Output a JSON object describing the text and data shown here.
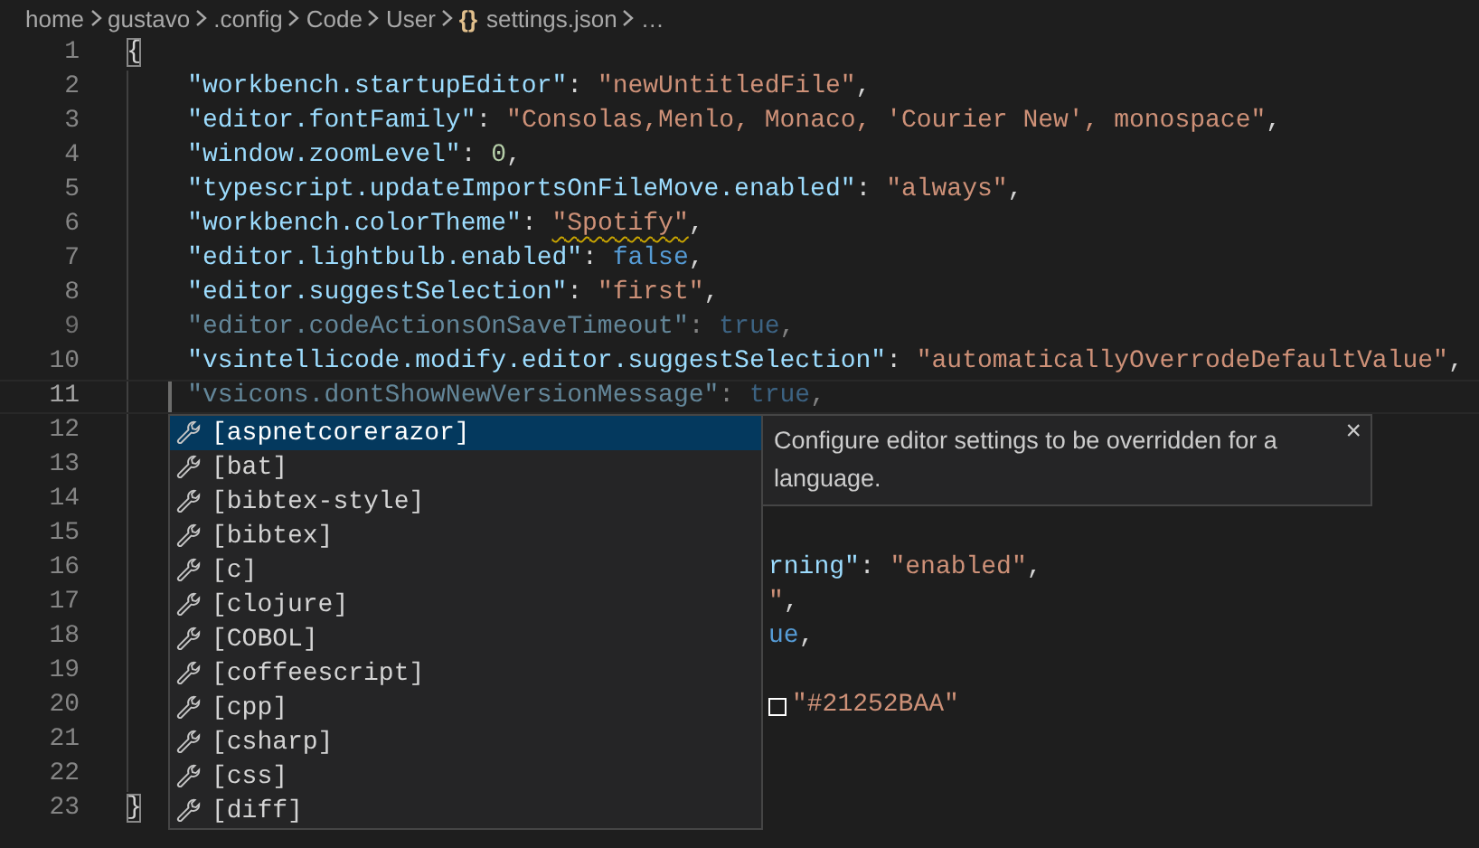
{
  "breadcrumb": {
    "items": [
      {
        "label": "home"
      },
      {
        "label": "gustavo"
      },
      {
        "label": ".config"
      },
      {
        "label": "Code"
      },
      {
        "label": "User"
      },
      {
        "label": "settings.json",
        "icon": "{}"
      },
      {
        "label": "…"
      }
    ]
  },
  "editor": {
    "lines": [
      {
        "number": "1",
        "kind": "full",
        "dimmed": false,
        "current": false,
        "tokens": [
          {
            "text": "{",
            "kind": "bracket-match"
          }
        ]
      },
      {
        "number": "2",
        "kind": "entry",
        "dimmed": false,
        "current": false,
        "tokens": [
          {
            "text": "\"workbench.startupEditor\"",
            "kind": "key"
          },
          {
            "text": ": ",
            "kind": "punct"
          },
          {
            "text": "\"newUntitledFile\"",
            "kind": "string"
          },
          {
            "text": ",",
            "kind": "punct"
          }
        ]
      },
      {
        "number": "3",
        "kind": "entry",
        "dimmed": false,
        "current": false,
        "tokens": [
          {
            "text": "\"editor.fontFamily\"",
            "kind": "key"
          },
          {
            "text": ": ",
            "kind": "punct"
          },
          {
            "text": "\"Consolas,Menlo, Monaco, 'Courier New', monospace\"",
            "kind": "string"
          },
          {
            "text": ",",
            "kind": "punct"
          }
        ]
      },
      {
        "number": "4",
        "kind": "entry",
        "dimmed": false,
        "current": false,
        "tokens": [
          {
            "text": "\"window.zoomLevel\"",
            "kind": "key"
          },
          {
            "text": ": ",
            "kind": "punct"
          },
          {
            "text": "0",
            "kind": "number"
          },
          {
            "text": ",",
            "kind": "punct"
          }
        ]
      },
      {
        "number": "5",
        "kind": "entry",
        "dimmed": false,
        "current": false,
        "tokens": [
          {
            "text": "\"typescript.updateImportsOnFileMove.enabled\"",
            "kind": "key"
          },
          {
            "text": ": ",
            "kind": "punct"
          },
          {
            "text": "\"always\"",
            "kind": "string"
          },
          {
            "text": ",",
            "kind": "punct"
          }
        ]
      },
      {
        "number": "6",
        "kind": "entry",
        "dimmed": false,
        "current": false,
        "tokens": [
          {
            "text": "\"workbench.colorTheme\"",
            "kind": "key"
          },
          {
            "text": ": ",
            "kind": "punct"
          },
          {
            "text": "\"Spotify\"",
            "kind": "warning-string"
          },
          {
            "text": ",",
            "kind": "punct"
          }
        ]
      },
      {
        "number": "7",
        "kind": "entry",
        "dimmed": false,
        "current": false,
        "tokens": [
          {
            "text": "\"editor.lightbulb.enabled\"",
            "kind": "key"
          },
          {
            "text": ": ",
            "kind": "punct"
          },
          {
            "text": "false",
            "kind": "bool"
          },
          {
            "text": ",",
            "kind": "punct"
          }
        ]
      },
      {
        "number": "8",
        "kind": "entry",
        "dimmed": false,
        "current": false,
        "tokens": [
          {
            "text": "\"editor.suggestSelection\"",
            "kind": "key"
          },
          {
            "text": ": ",
            "kind": "punct"
          },
          {
            "text": "\"first\"",
            "kind": "string"
          },
          {
            "text": ",",
            "kind": "punct"
          }
        ]
      },
      {
        "number": "9",
        "kind": "entry",
        "dimmed": true,
        "current": false,
        "tokens": [
          {
            "text": "\"editor.codeActionsOnSaveTimeout\"",
            "kind": "key"
          },
          {
            "text": ": ",
            "kind": "punct"
          },
          {
            "text": "true",
            "kind": "bool"
          },
          {
            "text": ",",
            "kind": "punct"
          }
        ]
      },
      {
        "number": "10",
        "kind": "entry",
        "dimmed": false,
        "current": false,
        "tokens": [
          {
            "text": "\"vsintellicode.modify.editor.suggestSelection\"",
            "kind": "key"
          },
          {
            "text": ": ",
            "kind": "punct"
          },
          {
            "text": "\"automaticallyOverrodeDefaultValue\"",
            "kind": "string"
          },
          {
            "text": ",",
            "kind": "punct"
          }
        ]
      },
      {
        "number": "11",
        "kind": "entry",
        "dimmed": true,
        "current": true,
        "tokens": [
          {
            "text": "\"vsicons.dontShowNewVersionMessage\"",
            "kind": "key"
          },
          {
            "text": ": ",
            "kind": "punct"
          },
          {
            "text": "true",
            "kind": "bool"
          },
          {
            "text": ",",
            "kind": "punct"
          }
        ]
      },
      {
        "number": "12",
        "kind": "partial",
        "dimmed": false,
        "current": false
      },
      {
        "number": "13",
        "kind": "partial",
        "dimmed": false,
        "current": false
      },
      {
        "number": "14",
        "kind": "partial",
        "dimmed": false,
        "current": false
      },
      {
        "number": "15",
        "kind": "partial",
        "dimmed": false,
        "current": false
      },
      {
        "number": "16",
        "kind": "partial",
        "dimmed": false,
        "current": false,
        "tokens": [
          {
            "text": "rning\"",
            "kind": "key"
          },
          {
            "text": ": ",
            "kind": "punct"
          },
          {
            "text": "\"enabled\"",
            "kind": "string"
          },
          {
            "text": ",",
            "kind": "punct"
          }
        ]
      },
      {
        "number": "17",
        "kind": "partial",
        "dimmed": false,
        "current": false,
        "tokens": [
          {
            "text": "\"",
            "kind": "string"
          },
          {
            "text": ",",
            "kind": "punct"
          }
        ]
      },
      {
        "number": "18",
        "kind": "partial",
        "dimmed": false,
        "current": false,
        "tokens": [
          {
            "text": "ue",
            "kind": "bool"
          },
          {
            "text": ",",
            "kind": "punct"
          }
        ]
      },
      {
        "number": "19",
        "kind": "partial",
        "dimmed": false,
        "current": false
      },
      {
        "number": "20",
        "kind": "partial",
        "dimmed": false,
        "current": false,
        "tokens": [
          {
            "kind": "swatch"
          },
          {
            "text": "\"#21252BAA\"",
            "kind": "string"
          }
        ]
      },
      {
        "number": "21",
        "kind": "partial",
        "dimmed": false,
        "current": false
      },
      {
        "number": "22",
        "kind": "partial",
        "dimmed": false,
        "current": false
      },
      {
        "number": "23",
        "kind": "full",
        "dimmed": false,
        "current": false,
        "tokens": [
          {
            "text": "}",
            "kind": "bracket-match"
          }
        ]
      }
    ]
  },
  "suggest": {
    "items": [
      {
        "label": "[aspnetcorerazor]",
        "selected": true
      },
      {
        "label": "[bat]",
        "selected": false
      },
      {
        "label": "[bibtex-style]",
        "selected": false
      },
      {
        "label": "[bibtex]",
        "selected": false
      },
      {
        "label": "[c]",
        "selected": false
      },
      {
        "label": "[clojure]",
        "selected": false
      },
      {
        "label": "[COBOL]",
        "selected": false
      },
      {
        "label": "[coffeescript]",
        "selected": false
      },
      {
        "label": "[cpp]",
        "selected": false
      },
      {
        "label": "[csharp]",
        "selected": false
      },
      {
        "label": "[css]",
        "selected": false
      },
      {
        "label": "[diff]",
        "selected": false
      }
    ],
    "details": {
      "text": "Configure editor settings to be overridden for a language.",
      "close": "×"
    }
  }
}
